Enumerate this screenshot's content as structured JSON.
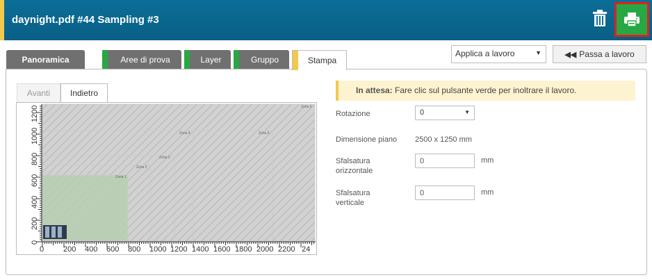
{
  "header": {
    "title": "daynight.pdf #44 Sampling #3",
    "accent_color": "#f2c94c",
    "bg_color": "#0b6e99",
    "trash_icon": "trash-icon",
    "print_icon": "printer-icon",
    "print_button_color": "#27a844"
  },
  "tabs": [
    {
      "label": "Panoramica"
    },
    {
      "label": "Aree di prova"
    },
    {
      "label": "Layer"
    },
    {
      "label": "Gruppo"
    },
    {
      "label": "Stampa"
    }
  ],
  "toolbar": {
    "apply_select_value": "Applica a lavoro",
    "pass_button_label": "Passa a lavoro"
  },
  "preview": {
    "tabs": [
      {
        "label": "Avanti"
      },
      {
        "label": "Indietro"
      }
    ],
    "x_ticks": [
      "0",
      "200",
      "400",
      "600",
      "800",
      "1000",
      "1200",
      "1400",
      "1600",
      "1800",
      "2000",
      "2200",
      "24"
    ],
    "y_ticks": [
      "0",
      "200",
      "400",
      "600",
      "800",
      "1000",
      "1200"
    ],
    "zones": [
      "Zona 1",
      "Zona 2",
      "Zona 3",
      "Zona 4",
      "Zona 5",
      "Zona 6"
    ]
  },
  "status": {
    "strong": "In attesa:",
    "text": "Fare clic sul pulsante verde per inoltrare il lavoro."
  },
  "form": {
    "rotation_label": "Rotazione",
    "rotation_value": "0",
    "dimension_label": "Dimensione piano",
    "dimension_value": "2500 x 1250 mm",
    "hoffset_label_1": "Sfalsatura",
    "hoffset_label_2": "orizzontale",
    "hoffset_value": "0",
    "hoffset_unit": "mm",
    "voffset_label_1": "Sfalsatura",
    "voffset_label_2": "verticale",
    "voffset_value": "0",
    "voffset_unit": "mm"
  }
}
